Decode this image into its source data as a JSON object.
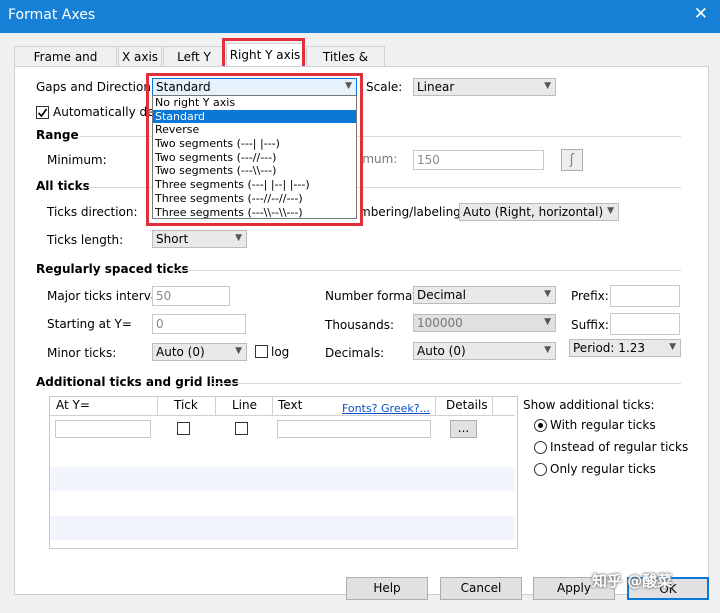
{
  "window": {
    "title": "Format Axes",
    "close": "✕"
  },
  "tabs": [
    "Frame and Origin",
    "X axis",
    "Left Y axis",
    "Right Y axis",
    "Titles & Fonts"
  ],
  "gaps": {
    "label": "Gaps and Direction:",
    "value": "Standard"
  },
  "auto_determine": {
    "label": "Automatically dete",
    "checked": true
  },
  "scale": {
    "label": "Scale:",
    "value": "Linear"
  },
  "range": {
    "title": "Range",
    "minimum_label": "Minimum:",
    "maximum_label": "imum:",
    "maximum_value": "150"
  },
  "all_ticks": {
    "title": "All ticks",
    "direction_label": "Ticks direction:",
    "numbering_label": "mbering/labeling:",
    "numbering_value": "Auto (Right, horizontal)",
    "length_label": "Ticks length:",
    "length_value": "Short"
  },
  "regular": {
    "title": "Regularly spaced ticks",
    "major_label": "Major ticks interval:",
    "major_value": "50",
    "start_label": "Starting at Y=",
    "start_value": "0",
    "minor_label": "Minor ticks:",
    "minor_value": "Auto (0)",
    "log_label": "log",
    "number_format_label": "Number format:",
    "number_format_value": "Decimal",
    "thousands_label": "Thousands:",
    "thousands_value": "100000",
    "decimals_label": "Decimals:",
    "decimals_value": "Auto (0)",
    "prefix_label": "Prefix:",
    "suffix_label": "Suffix:",
    "period_value": "Period: 1.23"
  },
  "additional": {
    "title": "Additional ticks and grid lines",
    "columns": [
      "At Y=",
      "Tick",
      "Line",
      "Text",
      "Fonts? Greek?...",
      "Details"
    ],
    "details_button": "...",
    "show_label": "Show additional ticks:",
    "options": [
      "With regular ticks",
      "Instead of regular ticks",
      "Only regular ticks"
    ],
    "selected": 0
  },
  "dropdown_options": [
    "No right Y axis",
    "Standard",
    "Reverse",
    "Two segments (---| |---)",
    "Two segments (---//---)",
    "Two segments (---\\\\---)",
    "Three segments (---| |--| |---)",
    "Three segments (---//--//---)",
    "Three segments (---\\\\--\\\\---)"
  ],
  "dropdown_selected": 1,
  "buttons": {
    "help": "Help",
    "cancel": "Cancel",
    "apply": "Apply",
    "ok": "OK"
  },
  "watermark": "知乎 @酸菜",
  "colors": {
    "titlebar": "#1580d6",
    "highlight": "#0a78d7",
    "annotation": "#e0303a"
  }
}
